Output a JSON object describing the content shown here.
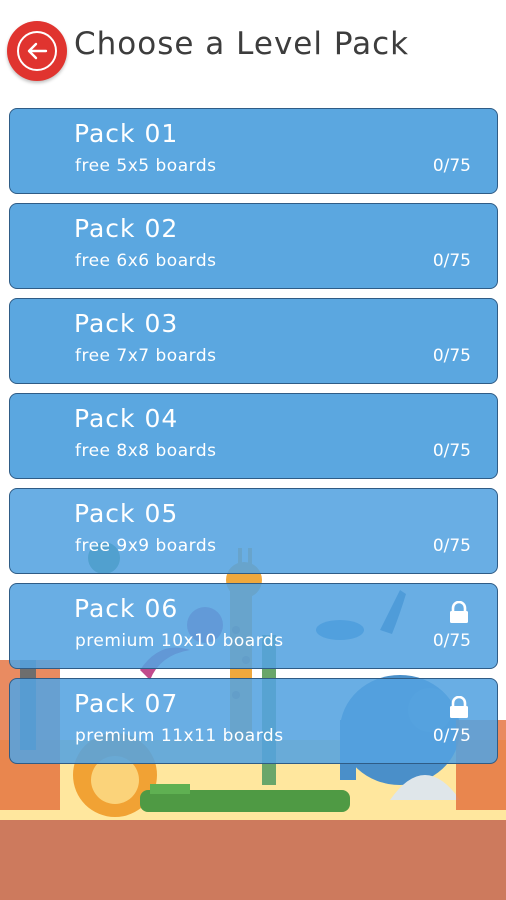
{
  "header": {
    "title": "Choose a Level Pack",
    "back_icon": "arrow-left-circle-icon"
  },
  "packs": [
    {
      "name": "Pack 01",
      "description": "free 5x5 boards",
      "progress": "0/75",
      "locked": false
    },
    {
      "name": "Pack 02",
      "description": "free 6x6 boards",
      "progress": "0/75",
      "locked": false
    },
    {
      "name": "Pack 03",
      "description": "free 7x7 boards",
      "progress": "0/75",
      "locked": false
    },
    {
      "name": "Pack 04",
      "description": "free 8x8 boards",
      "progress": "0/75",
      "locked": false
    },
    {
      "name": "Pack 05",
      "description": "free 9x9 boards",
      "progress": "0/75",
      "locked": false
    },
    {
      "name": "Pack 06",
      "description": "premium 10x10 boards",
      "progress": "0/75",
      "locked": true
    },
    {
      "name": "Pack 07",
      "description": "premium 11x11 boards",
      "progress": "0/75",
      "locked": true
    }
  ],
  "colors": {
    "back_button": "#e0342f",
    "pack_fill": "#5ba7e0",
    "pack_border": "#2f5c86",
    "ground": "#cd7a5d"
  }
}
